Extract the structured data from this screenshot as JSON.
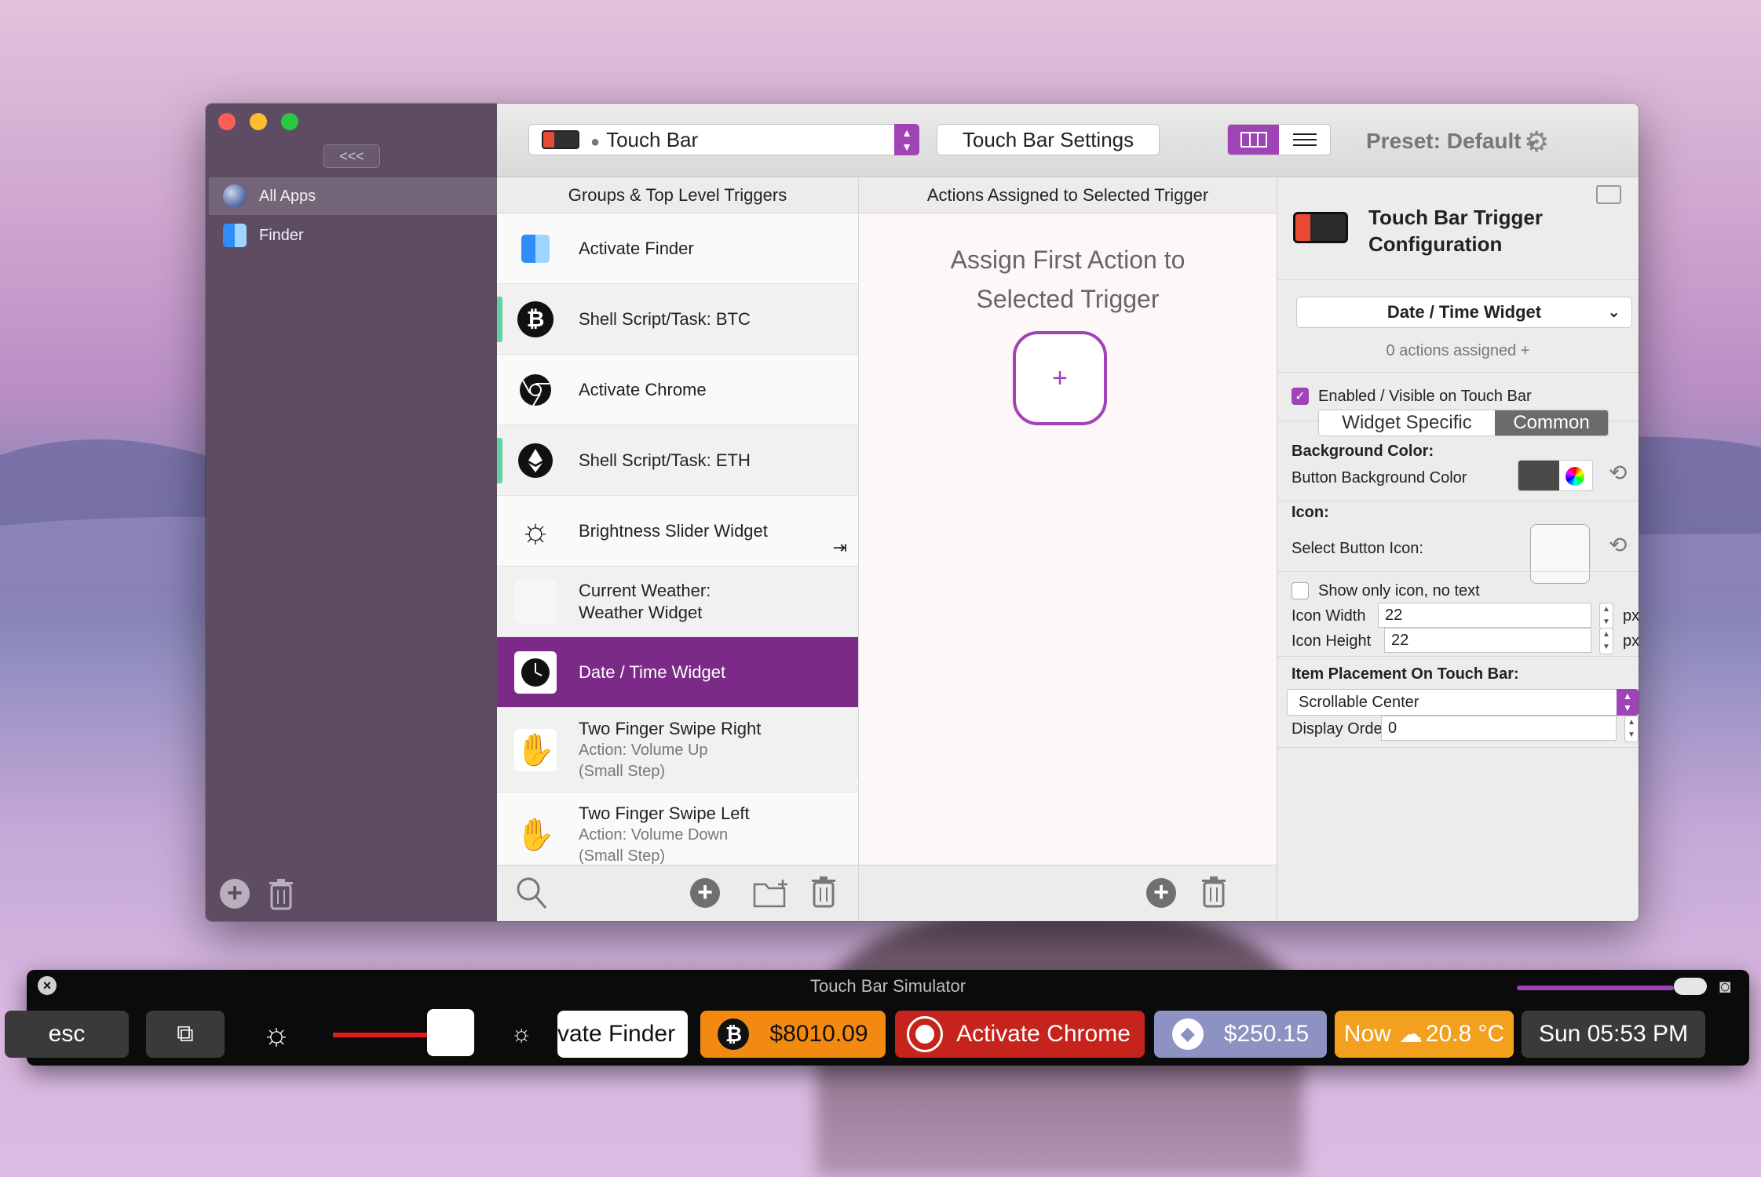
{
  "sidebar": {
    "collapse_label": "<<<",
    "items": [
      {
        "label": "All Apps",
        "icon": "globe-icon"
      },
      {
        "label": "Finder",
        "icon": "finder-icon"
      }
    ]
  },
  "toolbar": {
    "selector_label": "Touch Bar",
    "settings_button": "Touch Bar Settings",
    "preset_label": "Preset: Default",
    "accent_color": "#a043b6"
  },
  "columns": {
    "triggers_header": "Groups & Top Level Triggers",
    "actions_header": "Actions Assigned to Selected Trigger"
  },
  "triggers": [
    {
      "title": "Activate Finder",
      "icon": "finder-icon"
    },
    {
      "title": "Shell Script/Task: BTC",
      "icon": "bitcoin-icon"
    },
    {
      "title": "Activate Chrome",
      "icon": "chrome-icon"
    },
    {
      "title": "Shell Script/Task: ETH",
      "icon": "ethereum-icon"
    },
    {
      "title": "Brightness Slider Widget",
      "icon": "brightness-icon"
    },
    {
      "title_line1": "Current Weather:",
      "title_line2": "Weather Widget",
      "icon": "blank-icon"
    },
    {
      "title": "Date / Time Widget",
      "icon": "clock-icon"
    },
    {
      "title": "Two Finger Swipe Right",
      "sub1": "Action: Volume Up",
      "sub2": "(Small Step)",
      "icon": "hand-icon"
    },
    {
      "title": "Two Finger Swipe Left",
      "sub1": "Action: Volume Down",
      "sub2": "(Small Step)",
      "icon": "hand-icon"
    }
  ],
  "actions": {
    "assign_line1": "Assign First Action to",
    "assign_line2": "Selected Trigger",
    "add_label": "+"
  },
  "config": {
    "title_line1": "Touch Bar Trigger",
    "title_line2": "Configuration",
    "trigger_type": "Date / Time Widget",
    "actions_assigned": "0 actions assigned +",
    "enabled_label": "Enabled / Visible on Touch Bar",
    "tab_widget": "Widget Specific",
    "tab_common": "Common",
    "bg_color_heading": "Background Color:",
    "bg_color_label": "Button Background Color",
    "icon_heading": "Icon:",
    "select_icon_label": "Select Button Icon:",
    "only_icon_label": "Show only icon, no text",
    "icon_width_label": "Icon Width",
    "icon_width_value": "22",
    "icon_height_label": "Icon Height",
    "icon_height_value": "22",
    "px": "px",
    "placement_heading": "Item Placement On Touch Bar:",
    "placement_value": "Scrollable Center",
    "display_order_label": "Display Order",
    "display_order_value": "0"
  },
  "simulator": {
    "title": "Touch Bar Simulator",
    "esc": "esc",
    "finder_partial": "vate Finder",
    "btc_value": "$8010.09",
    "chrome_label": "Activate Chrome",
    "eth_value": "$250.15",
    "weather_label": "Now",
    "weather_value": "20.8 °C",
    "datetime": "Sun 05:53 PM",
    "colors": {
      "btc": "#f28a12",
      "chrome": "#c5231b",
      "eth": "#8d92c3",
      "weather": "#f3a01f",
      "date": "#3a3a3a"
    }
  }
}
